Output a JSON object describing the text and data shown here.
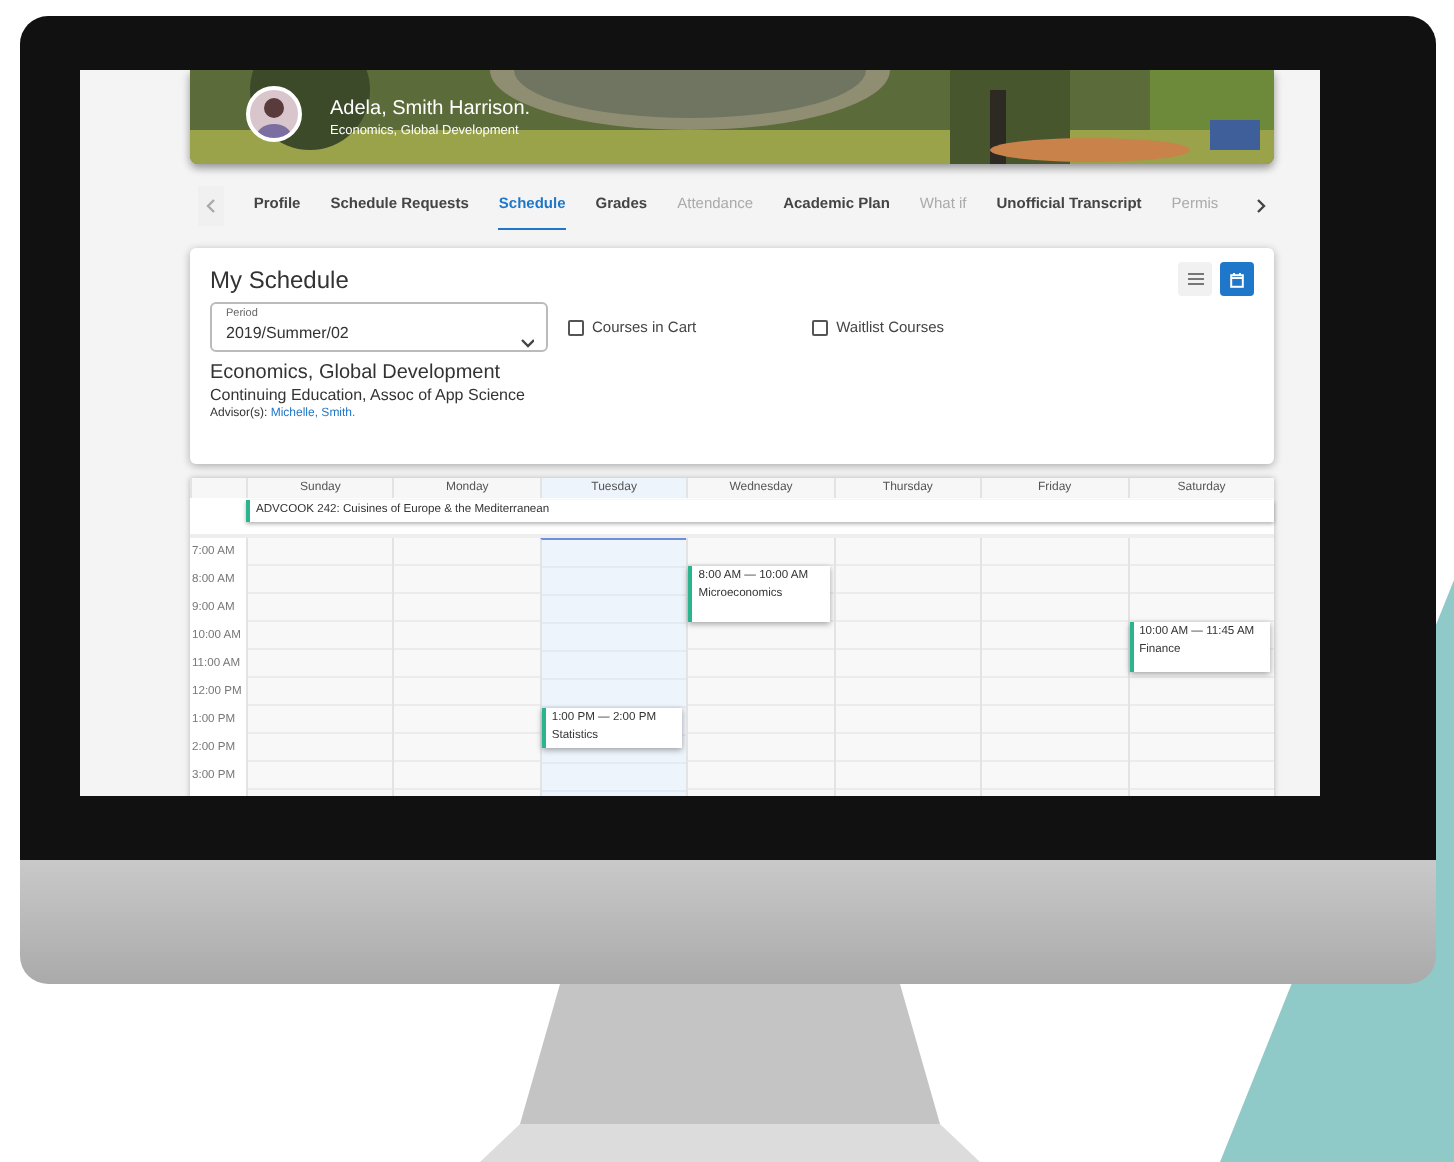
{
  "profile": {
    "name": "Adela, Smith Harrison.",
    "program": "Economics, Global Development"
  },
  "tabs": [
    {
      "label": "Profile",
      "selected": false,
      "disabled": false
    },
    {
      "label": "Schedule Requests",
      "selected": false,
      "disabled": false
    },
    {
      "label": "Schedule",
      "selected": true,
      "disabled": false
    },
    {
      "label": "Grades",
      "selected": false,
      "disabled": false
    },
    {
      "label": "Attendance",
      "selected": false,
      "disabled": true
    },
    {
      "label": "Academic Plan",
      "selected": false,
      "disabled": false
    },
    {
      "label": "What if",
      "selected": false,
      "disabled": true
    },
    {
      "label": "Unofficial Transcript",
      "selected": false,
      "disabled": false
    },
    {
      "label": "Permis",
      "selected": false,
      "disabled": true
    }
  ],
  "schedule": {
    "title": "My Schedule",
    "views": [
      {
        "kind": "list",
        "selected": false
      },
      {
        "kind": "calendar",
        "selected": true
      }
    ],
    "period": {
      "label": "Period",
      "value": "2019/Summer/02"
    },
    "filters": [
      {
        "label": "Courses in Cart",
        "checked": false
      },
      {
        "label": "Waitlist Courses",
        "checked": false
      }
    ],
    "program": "Economics, Global Development",
    "degree": "Continuing Education, Assoc of App Science",
    "advisor_label": "Advisor(s):",
    "advisor": "Michelle, Smith."
  },
  "calendar": {
    "all_day": [
      {
        "title": "ADVCOOK 242: Cuisines of Europe & the Mediterranean"
      }
    ],
    "hours": [
      "7:00 AM",
      "8:00 AM",
      "9:00 AM",
      "10:00 AM",
      "11:00 AM",
      "12:00 PM",
      "1:00 PM",
      "2:00 PM",
      "3:00 PM"
    ],
    "days": [
      {
        "name": "Sunday",
        "today": false
      },
      {
        "name": "Monday",
        "today": false
      },
      {
        "name": "Tuesday",
        "today": true,
        "events": [
          {
            "time": "1:00 PM — 2:00 PM",
            "title": "Statistics"
          }
        ]
      },
      {
        "name": "Wednesday",
        "today": false,
        "events": [
          {
            "time": "8:00 AM — 10:00 AM",
            "title": "Microeconomics"
          }
        ]
      },
      {
        "name": "Thursday",
        "today": false
      },
      {
        "name": "Friday",
        "today": false
      },
      {
        "name": "Saturday",
        "today": false,
        "events": [
          {
            "time": "10:00 AM — 11:45 AM",
            "title": "Finance"
          }
        ]
      }
    ]
  }
}
